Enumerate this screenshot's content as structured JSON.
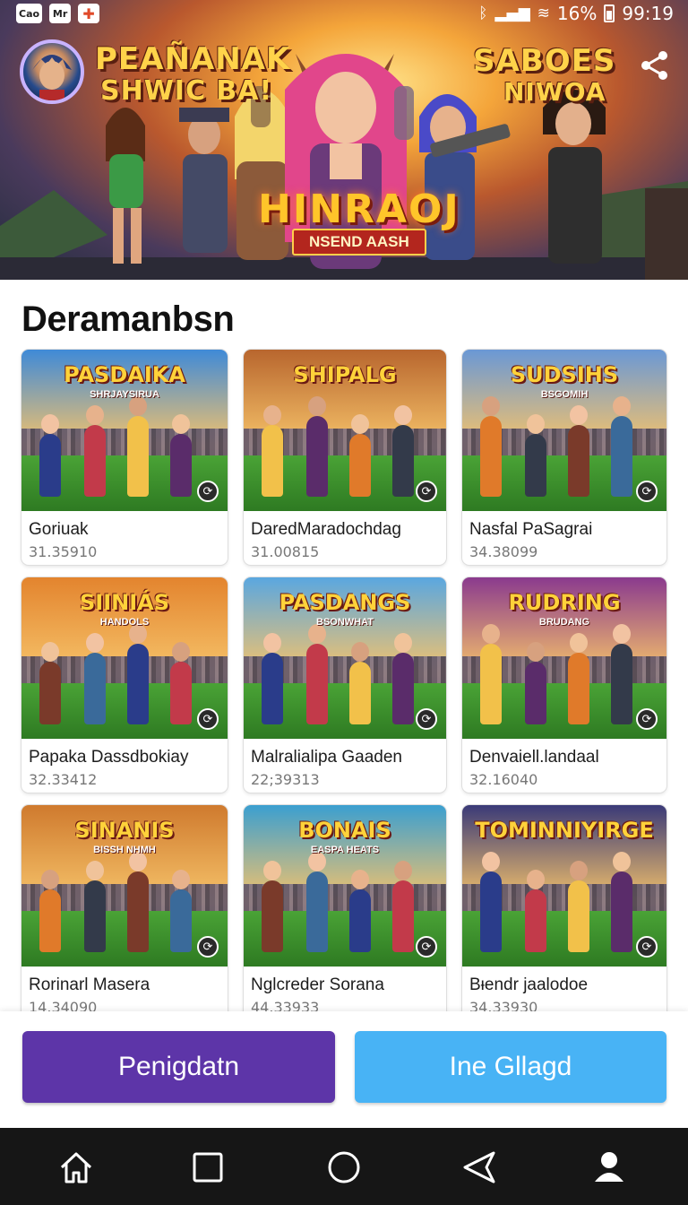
{
  "status_bar": {
    "notifications": [
      "Cao",
      "Mr",
      "✚"
    ],
    "battery": "16%",
    "time": "99:19"
  },
  "hero": {
    "title_left_line1": "PEAÑANAK",
    "title_left_line2": "SHWIC BA!",
    "title_right_line1": "SABOES",
    "title_right_line2": "NIWOA",
    "logo_main": "HINRAOJ",
    "logo_sub": "NSEND AASH",
    "share_icon": "share-icon"
  },
  "section": {
    "title": "Deramanbsn"
  },
  "games": [
    {
      "art_title": "PASDAIKA",
      "art_sub": "SHRJAYSIRUA",
      "name": "Goriuak",
      "number": "31.35910",
      "theme": "#3f8ad8"
    },
    {
      "art_title": "SHIPALG",
      "art_sub": "",
      "name": "DaredMaradochdag",
      "number": "31.00815",
      "theme": "#b8662e"
    },
    {
      "art_title": "SUDSIHS",
      "art_sub": "BSGOMIH",
      "name": "Nasfal PaSagrai",
      "number": "34.38099",
      "theme": "#6a98d6"
    },
    {
      "art_title": "SIINIÁS",
      "art_sub": "HANDOLS",
      "name": "Papaka Dassdbokiay",
      "number": "32.33412",
      "theme": "#e3842e"
    },
    {
      "art_title": "PASDANGS",
      "art_sub": "BSONWHAT",
      "name": "Malralialipa Gaaden",
      "number": "22;39313",
      "theme": "#5aa7e0"
    },
    {
      "art_title": "RUDRING",
      "art_sub": "BRUDANG",
      "name": "Denvaiell.landaal",
      "number": "32.16040",
      "theme": "#8a3a8e"
    },
    {
      "art_title": "SINANIS",
      "art_sub": "BISSH NHMH",
      "name": "Rorinarl Masera",
      "number": "14.34090",
      "theme": "#cf7a2e"
    },
    {
      "art_title": "BONAIS",
      "art_sub": "EASPA HEATS",
      "name": "Nglcreder Sorana",
      "number": "44.33933",
      "theme": "#3b9fd0"
    },
    {
      "art_title": "TOMINNIYIRGE",
      "art_sub": "",
      "name": "Bᵻendr jaalodoe",
      "number": "34.33930",
      "theme": "#3a3a78"
    }
  ],
  "actions": {
    "primary_label": "Penigdatn",
    "secondary_label": "Ine Gllagd"
  },
  "nav": [
    "home-icon",
    "square-icon",
    "circle-icon",
    "back-icon",
    "profile-icon"
  ]
}
